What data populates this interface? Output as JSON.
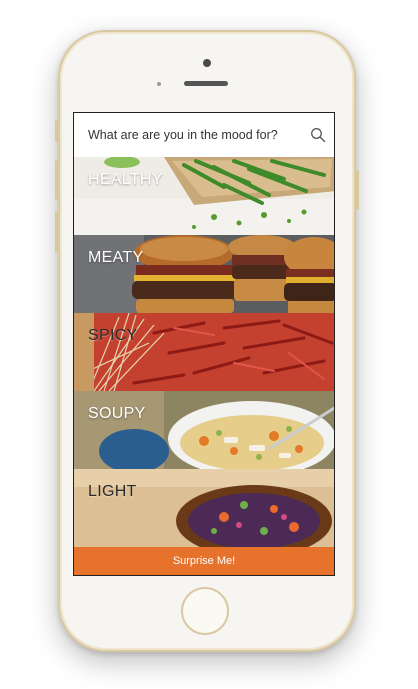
{
  "search": {
    "placeholder": "What are are you in the mood for?"
  },
  "categories": [
    {
      "label": "HEALTHY"
    },
    {
      "label": "MEATY"
    },
    {
      "label": "SPICY"
    },
    {
      "label": "SOUPY"
    },
    {
      "label": "LIGHT"
    }
  ],
  "surprise_label": "Surprise Me!",
  "colors": {
    "accent": "#e7722c",
    "phone_trim": "#d9c9a3"
  }
}
